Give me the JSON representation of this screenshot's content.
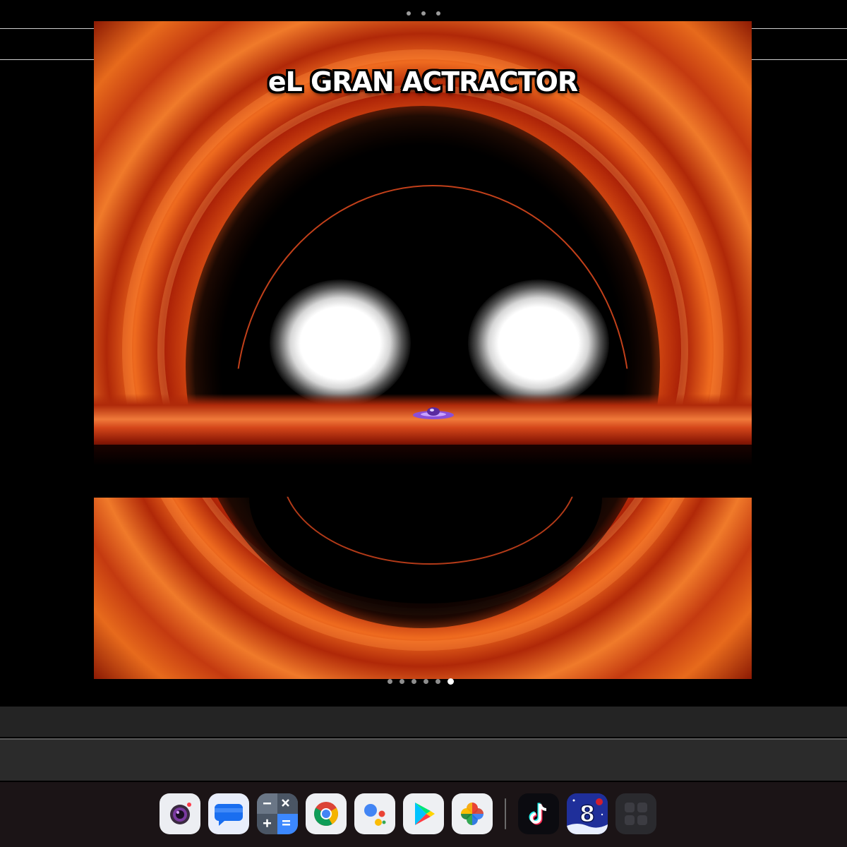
{
  "media": {
    "title": "eL GRAN ACTRACTOR"
  },
  "pager": {
    "total": 6,
    "active_index": 5
  },
  "dock": {
    "apps": [
      {
        "icon": "camera-app-icon"
      },
      {
        "icon": "messages-app-icon"
      },
      {
        "icon": "calculator-app-icon"
      },
      {
        "icon": "chrome-app-icon"
      },
      {
        "icon": "google-assistant-app-icon"
      },
      {
        "icon": "play-store-app-icon"
      },
      {
        "icon": "photos-app-icon"
      },
      {
        "icon": "tiktok-app-icon"
      },
      {
        "icon": "game-app-icon"
      },
      {
        "icon": "app-drawer-icon"
      }
    ]
  },
  "colors": {
    "background": "#000000",
    "taskbar": "#1b1416",
    "bar_top": "#242424",
    "bar_bottom": "#2b2b2b",
    "accent_orange": "#e76a1c"
  }
}
